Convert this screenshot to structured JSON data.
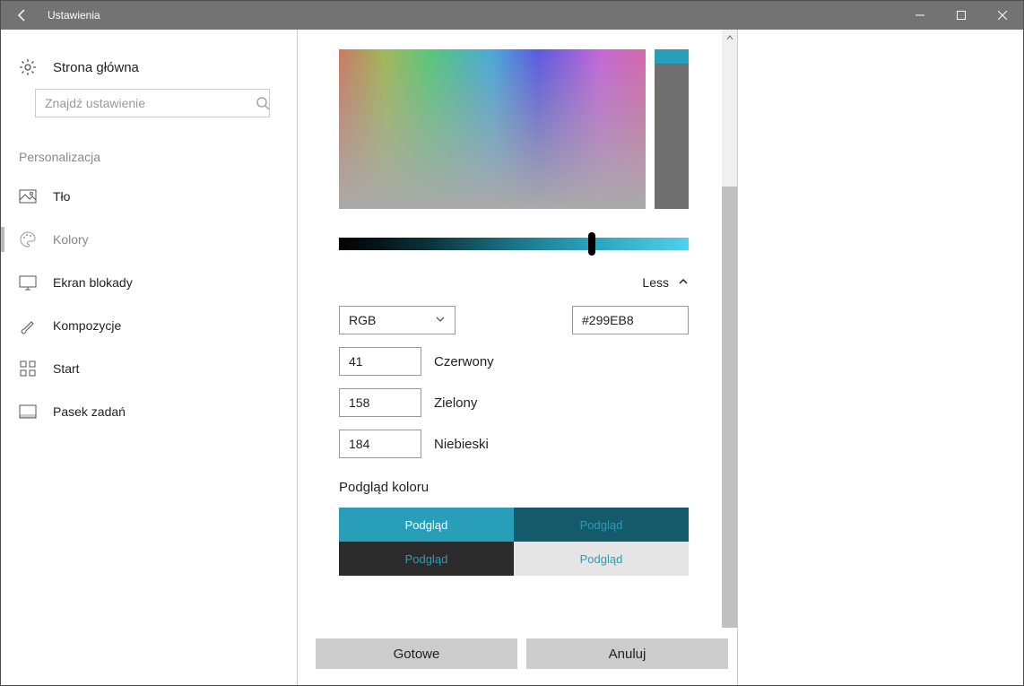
{
  "titlebar": {
    "title": "Ustawienia"
  },
  "sidebar": {
    "home": "Strona główna",
    "search_placeholder": "Znajdź ustawienie",
    "section": "Personalizacja",
    "items": [
      {
        "label": "Tło"
      },
      {
        "label": "Kolory"
      },
      {
        "label": "Ekran blokady"
      },
      {
        "label": "Kompozycje"
      },
      {
        "label": "Start"
      },
      {
        "label": "Pasek zadań"
      }
    ]
  },
  "picker": {
    "less": "Less",
    "model": "RGB",
    "hex": "#299EB8",
    "r": "41",
    "r_label": "Czerwony",
    "g": "158",
    "g_label": "Zielony",
    "b": "184",
    "b_label": "Niebieski",
    "preview_title": "Podgląd koloru",
    "preview_label": "Podgląd",
    "done": "Gotowe",
    "cancel": "Anuluj",
    "accent": "#299EB8"
  }
}
